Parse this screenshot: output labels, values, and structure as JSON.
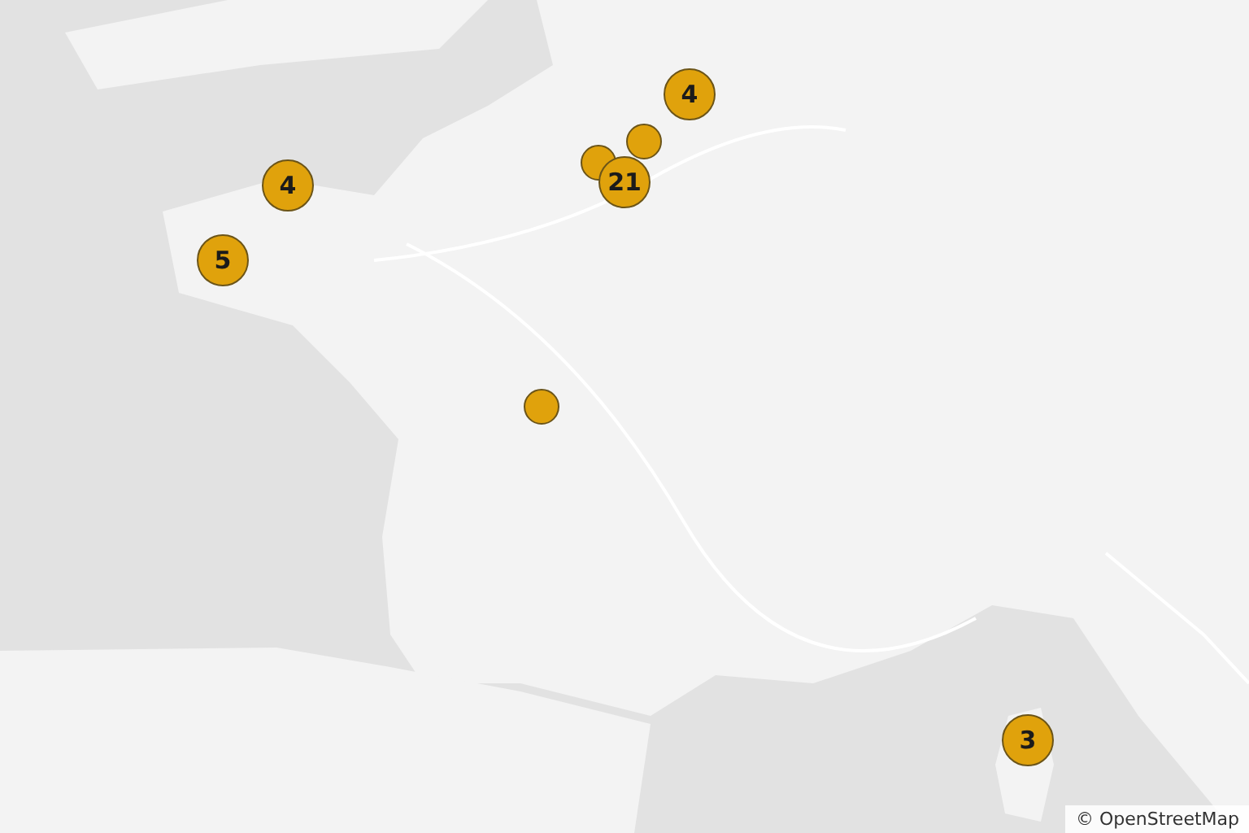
{
  "map": {
    "markers": [
      {
        "kind": "cluster",
        "count": "4"
      },
      {
        "kind": "point"
      },
      {
        "kind": "point"
      },
      {
        "kind": "cluster",
        "count": "21"
      },
      {
        "kind": "cluster",
        "count": "4"
      },
      {
        "kind": "cluster",
        "count": "5"
      },
      {
        "kind": "point"
      },
      {
        "kind": "cluster",
        "count": "3"
      }
    ],
    "attribution": "© OpenStreetMap"
  }
}
